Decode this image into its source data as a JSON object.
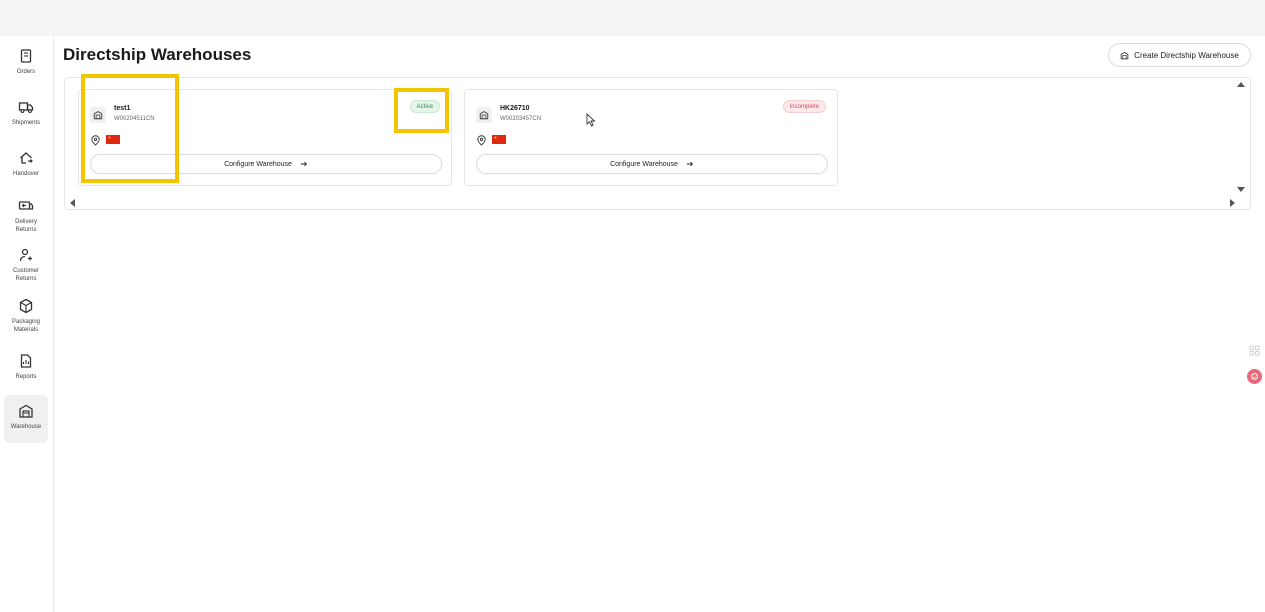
{
  "page": {
    "title": "Directship Warehouses",
    "create_button": "Create Directship Warehouse"
  },
  "sidebar": {
    "items": [
      {
        "label": "Orders",
        "icon": "orders-icon"
      },
      {
        "label": "Shipments",
        "icon": "truck-icon"
      },
      {
        "label": "Handover",
        "icon": "handover-icon"
      },
      {
        "label": "Delivery Returns",
        "icon": "delivery-returns-icon"
      },
      {
        "label": "Customer Returns",
        "icon": "customer-returns-icon"
      },
      {
        "label": "Packaging Materials",
        "icon": "package-icon"
      },
      {
        "label": "Reports",
        "icon": "reports-icon"
      },
      {
        "label": "Warehouse",
        "icon": "warehouse-icon",
        "active": true
      }
    ]
  },
  "warehouses": [
    {
      "name": "test1",
      "code": "W00204511CN",
      "status": "Active",
      "country_flag": "China",
      "configure_label": "Configure Warehouse"
    },
    {
      "name": "HK26710",
      "code": "W00203457CN",
      "status": "Incomplete",
      "country_flag": "China",
      "configure_label": "Configure Warehouse"
    }
  ],
  "colors": {
    "highlight": "#f5c400",
    "active_badge": "#2e8b4a",
    "incomplete_badge": "#d0505f",
    "flag_red": "#de2910"
  }
}
